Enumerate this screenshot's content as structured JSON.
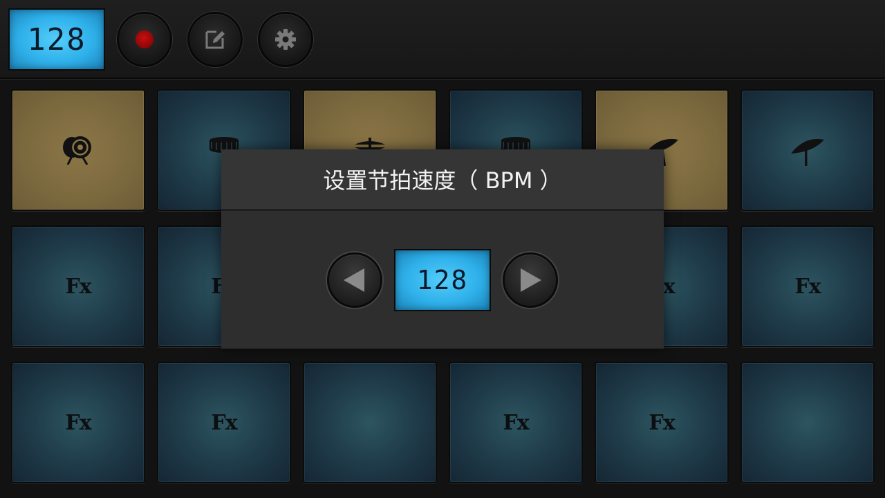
{
  "header": {
    "bpm_display": "128",
    "buttons": [
      {
        "name": "record",
        "icon": "record-icon"
      },
      {
        "name": "edit",
        "icon": "edit-icon"
      },
      {
        "name": "settings",
        "icon": "gear-icon"
      }
    ]
  },
  "pads": {
    "row1": [
      {
        "style": "gold",
        "icon": "bass-drum-icon"
      },
      {
        "style": "blue",
        "icon": "snare-drum-icon"
      },
      {
        "style": "gold",
        "icon": "hihat-icon"
      },
      {
        "style": "blue",
        "icon": "tom-drum-icon"
      },
      {
        "style": "gold",
        "icon": "crash-cymbal-icon"
      },
      {
        "style": "blue",
        "icon": "ride-cymbal-icon"
      }
    ],
    "row2": [
      "Fx",
      "Fx",
      "",
      "",
      "Fx",
      "Fx"
    ],
    "row3": [
      "Fx",
      "Fx",
      "",
      "Fx",
      "Fx",
      ""
    ]
  },
  "dialog": {
    "title": "设置节拍速度（ BPM ）",
    "bpm_value": "128",
    "decrease_icon": "triangle-left-icon",
    "increase_icon": "triangle-right-icon"
  },
  "colors": {
    "lcd": "#2fb0ea",
    "pad_blue": "#1f3b4a",
    "pad_gold": "#7c6a3f",
    "record": "#b00000"
  }
}
